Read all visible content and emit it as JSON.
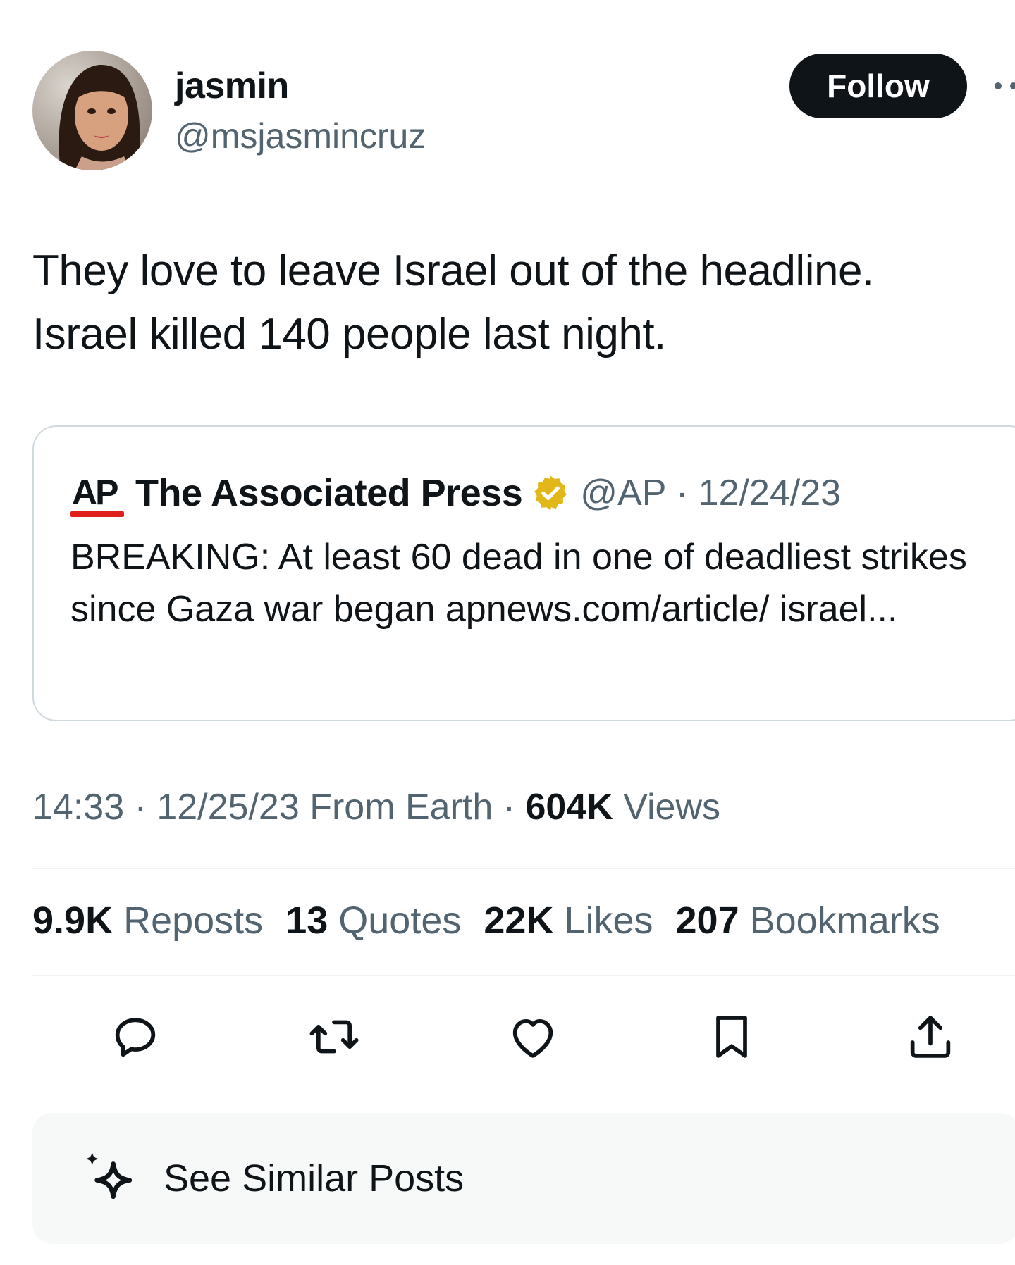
{
  "author": {
    "display_name": "jasmin",
    "handle": "@msjasmincruz",
    "follow_label": "Follow"
  },
  "tweet": {
    "line1": "They love to leave Israel out of the headline.",
    "line2": "Israel killed 140 people last night."
  },
  "quoted": {
    "logo_text": "AP",
    "name": "The Associated Press",
    "meta": "@AP · 12/24/23",
    "text": "BREAKING: At least 60 dead in one of deadliest strikes since Gaza war began apnews.com/article/ israel..."
  },
  "timestamp": {
    "prefix": "14:33 · 12/25/23 From Earth · ",
    "views_count": "604K",
    "views_label": " Views"
  },
  "stats": [
    {
      "num": "9.9K",
      "label": " Reposts"
    },
    {
      "num": "13",
      "label": " Quotes"
    },
    {
      "num": "22K",
      "label": " Likes"
    },
    {
      "num": "207",
      "label": " Bookmarks"
    }
  ],
  "actions": [
    "reply-icon",
    "repost-icon",
    "like-icon",
    "bookmark-icon",
    "share-icon"
  ],
  "similar": {
    "label": "See Similar Posts",
    "icon": "sparkle-icon"
  },
  "colors": {
    "text": "#0f1419",
    "secondary": "#536471",
    "border": "#cfd9de",
    "ap_red": "#e0201c",
    "verified_gold": "#e2b719",
    "similar_bg": "#f7f9f9"
  }
}
